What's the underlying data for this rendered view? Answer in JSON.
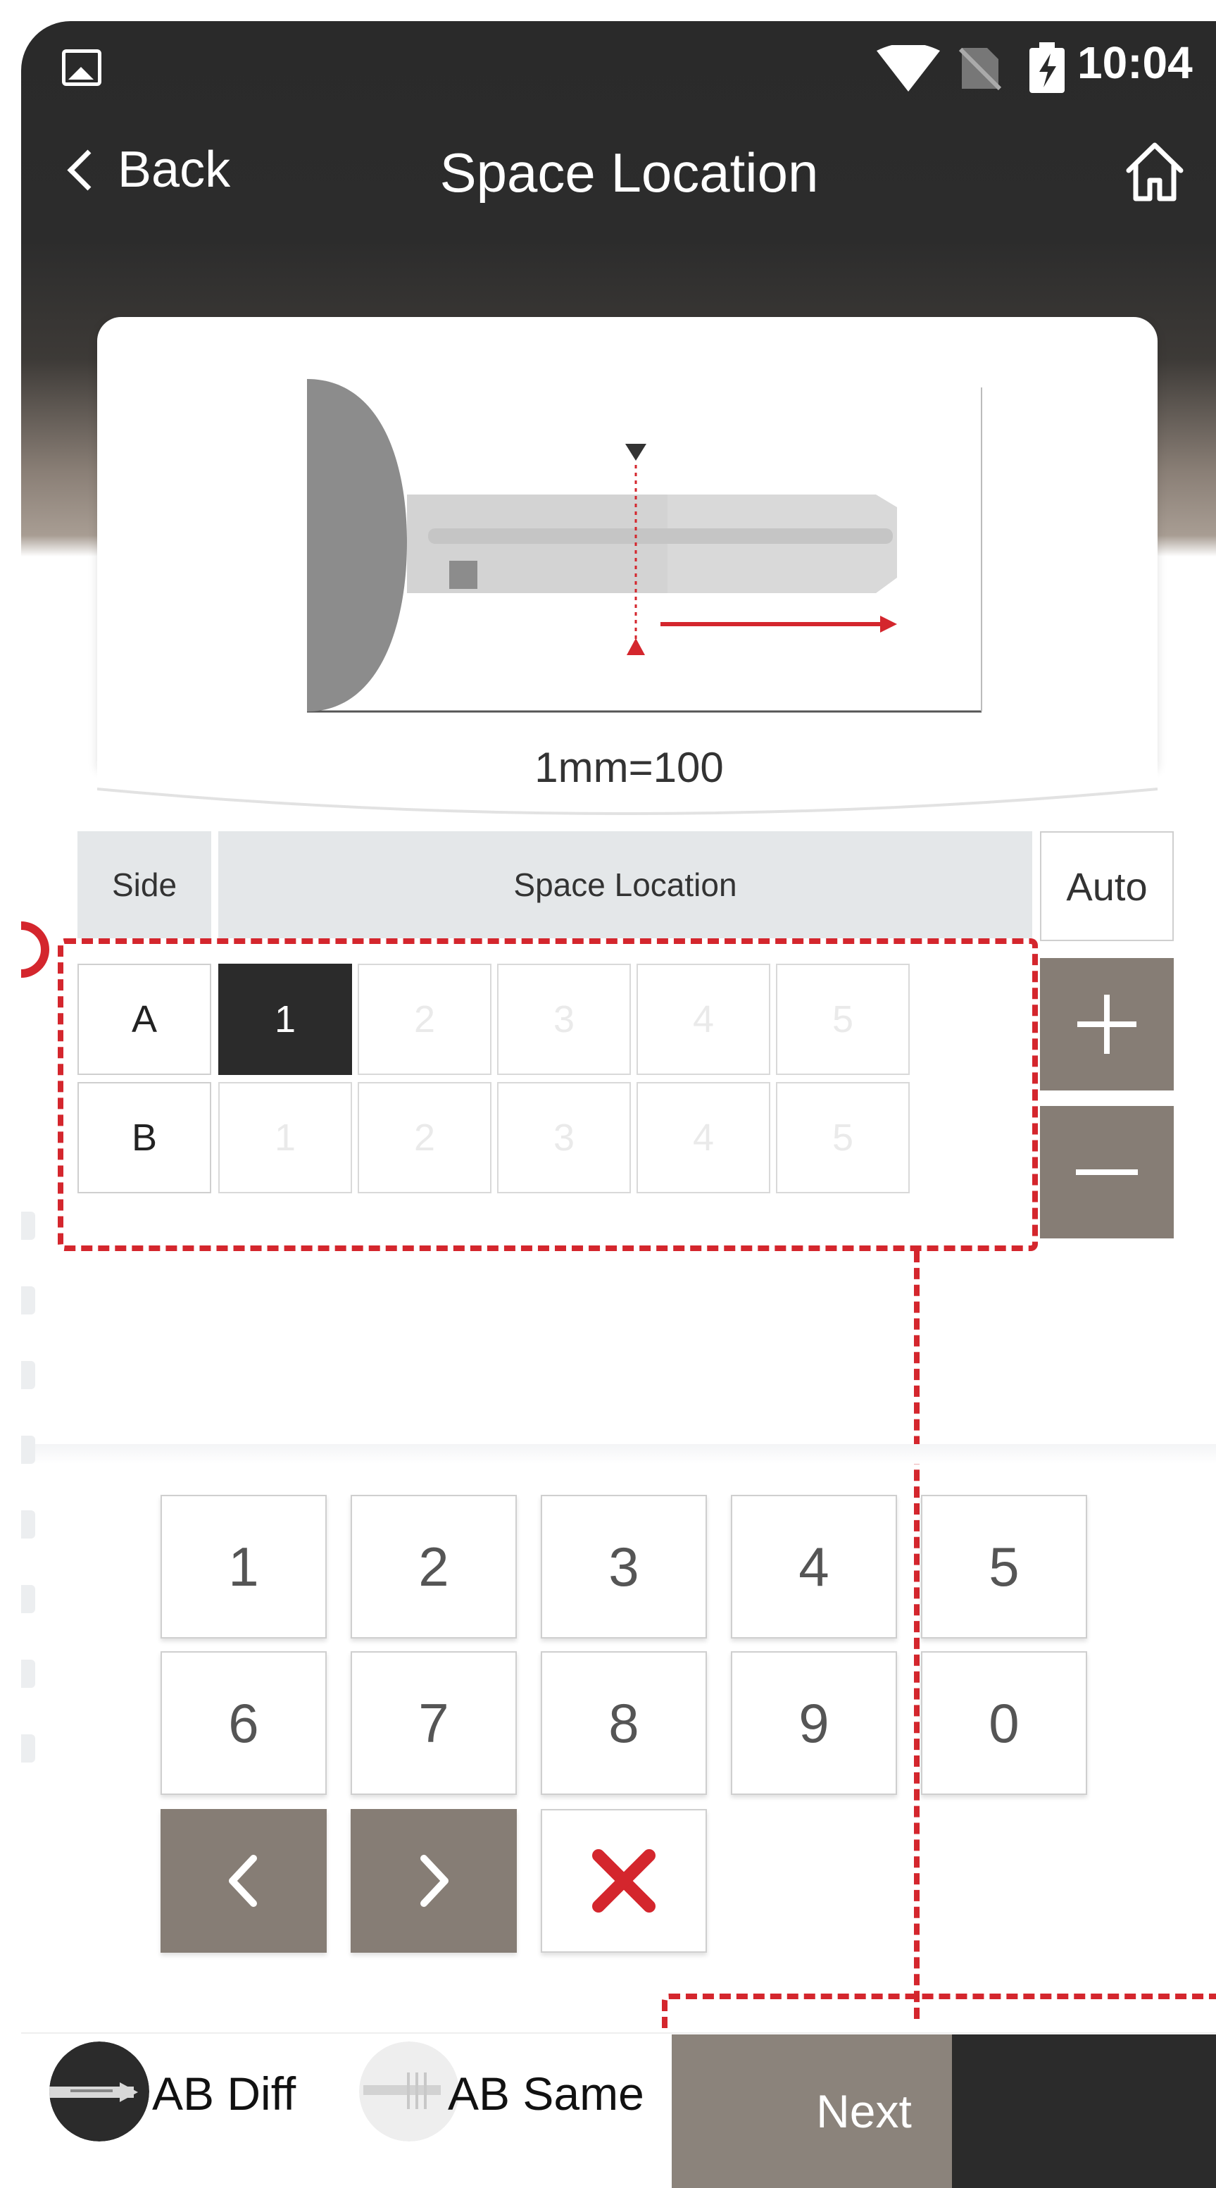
{
  "status_bar": {
    "time": "10:04",
    "icons": [
      "image-icon",
      "wifi-icon",
      "no-sim-icon",
      "battery-charging-icon"
    ]
  },
  "nav": {
    "back_label": "Back",
    "title": "Space Location",
    "home_icon": "home-icon"
  },
  "key_diagram": {
    "scale_label": "1mm=100"
  },
  "table": {
    "header_side": "Side",
    "header_space": "Space Location",
    "auto_label": "Auto",
    "rows": [
      {
        "side": "A",
        "positions": [
          "1",
          "2",
          "3",
          "4",
          "5"
        ],
        "active_index": 0
      },
      {
        "side": "B",
        "positions": [
          "1",
          "2",
          "3",
          "4",
          "5"
        ],
        "active_index": -1
      }
    ],
    "plus_icon": "plus-icon",
    "minus_icon": "minus-icon"
  },
  "keypad": {
    "digits": [
      "1",
      "2",
      "3",
      "4",
      "5",
      "6",
      "7",
      "8",
      "9",
      "0"
    ],
    "prev_icon": "chevron-left-icon",
    "next_icon": "chevron-right-icon",
    "clear_icon": "close-icon"
  },
  "bottom": {
    "mode_ab_diff": "AB Diff",
    "mode_ab_same": "AB Same",
    "next_label": "Next"
  },
  "colors": {
    "accent_red": "#d4262d",
    "button_taupe": "#867d75",
    "active_dark": "#2b2b2b"
  }
}
